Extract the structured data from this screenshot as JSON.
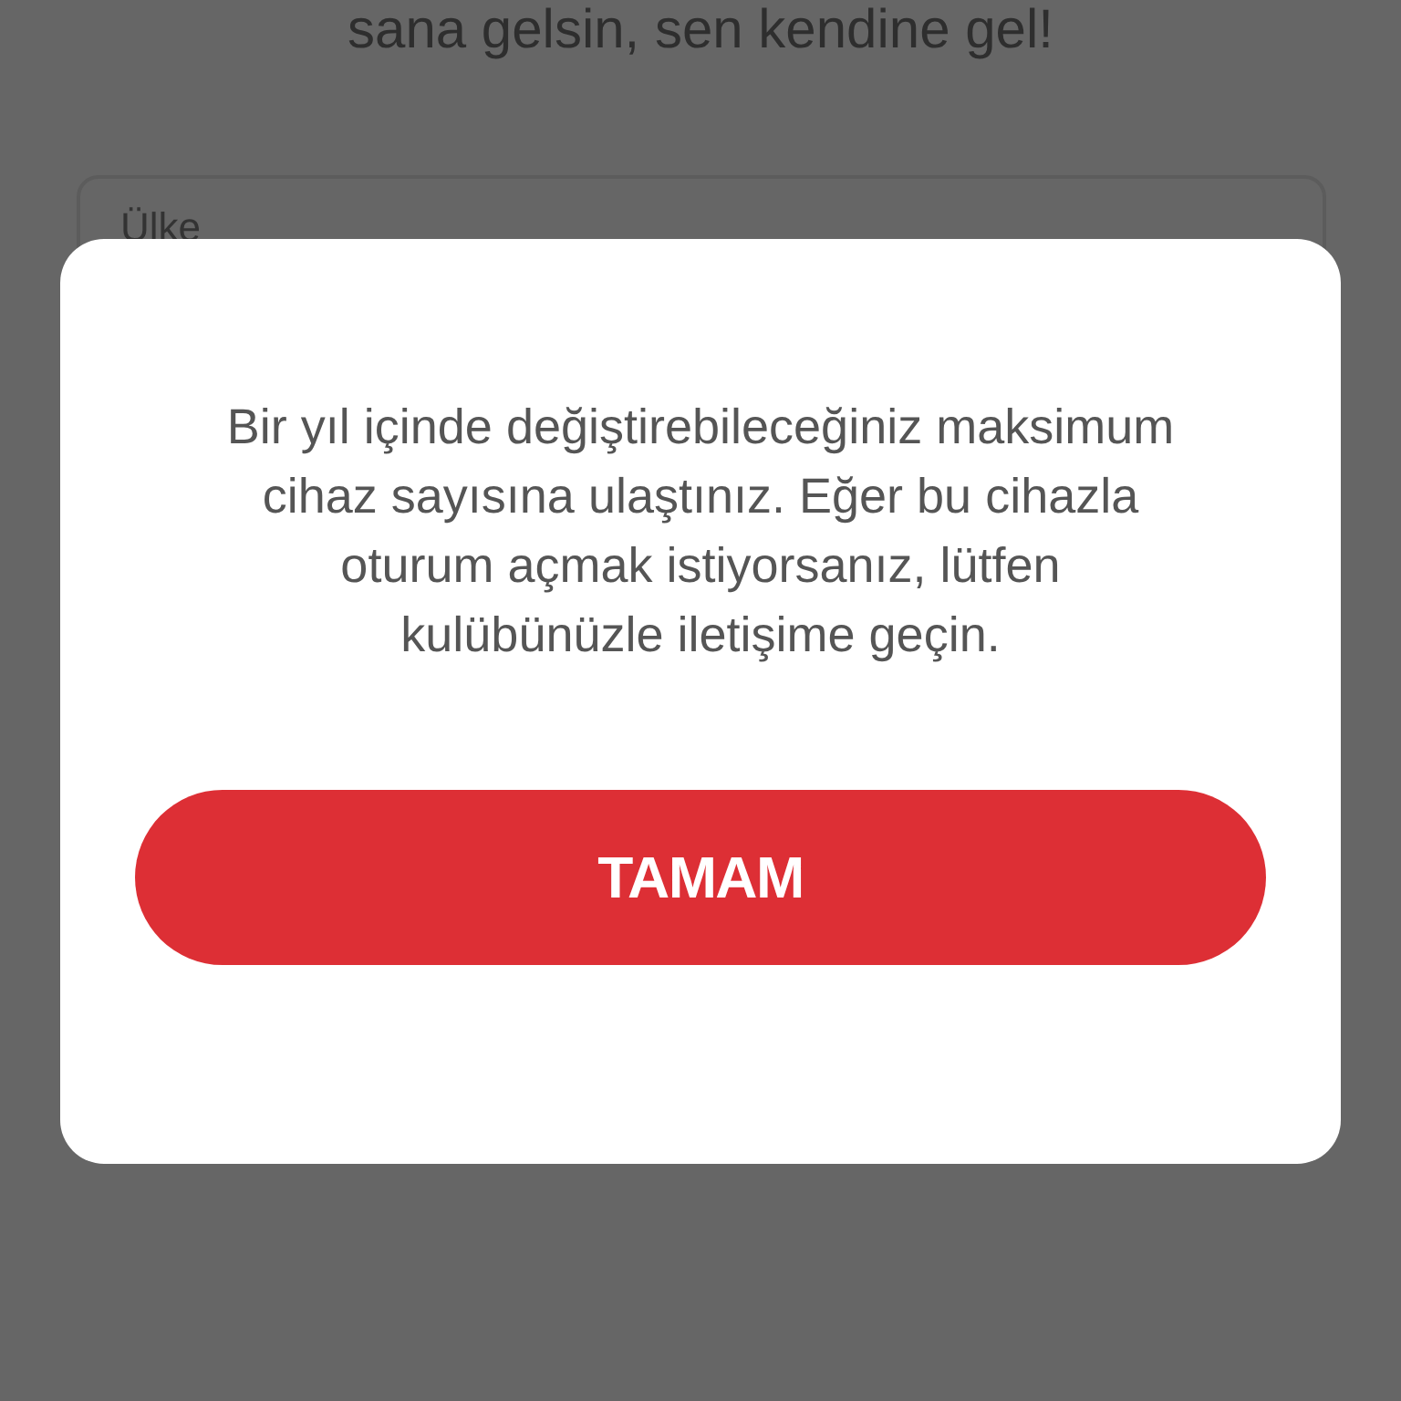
{
  "background": {
    "tagline": "sana gelsin, sen kendine gel!",
    "country_field": {
      "placeholder": "Ülke"
    }
  },
  "dialog": {
    "message": "Bir yıl içinde değiştirebileceğiniz maksimum cihaz sayısına ulaştınız. Eğer bu cihazla oturum açmak istiyorsanız, lütfen kulübünüzle iletişime geçin.",
    "button": "TAMAM"
  }
}
